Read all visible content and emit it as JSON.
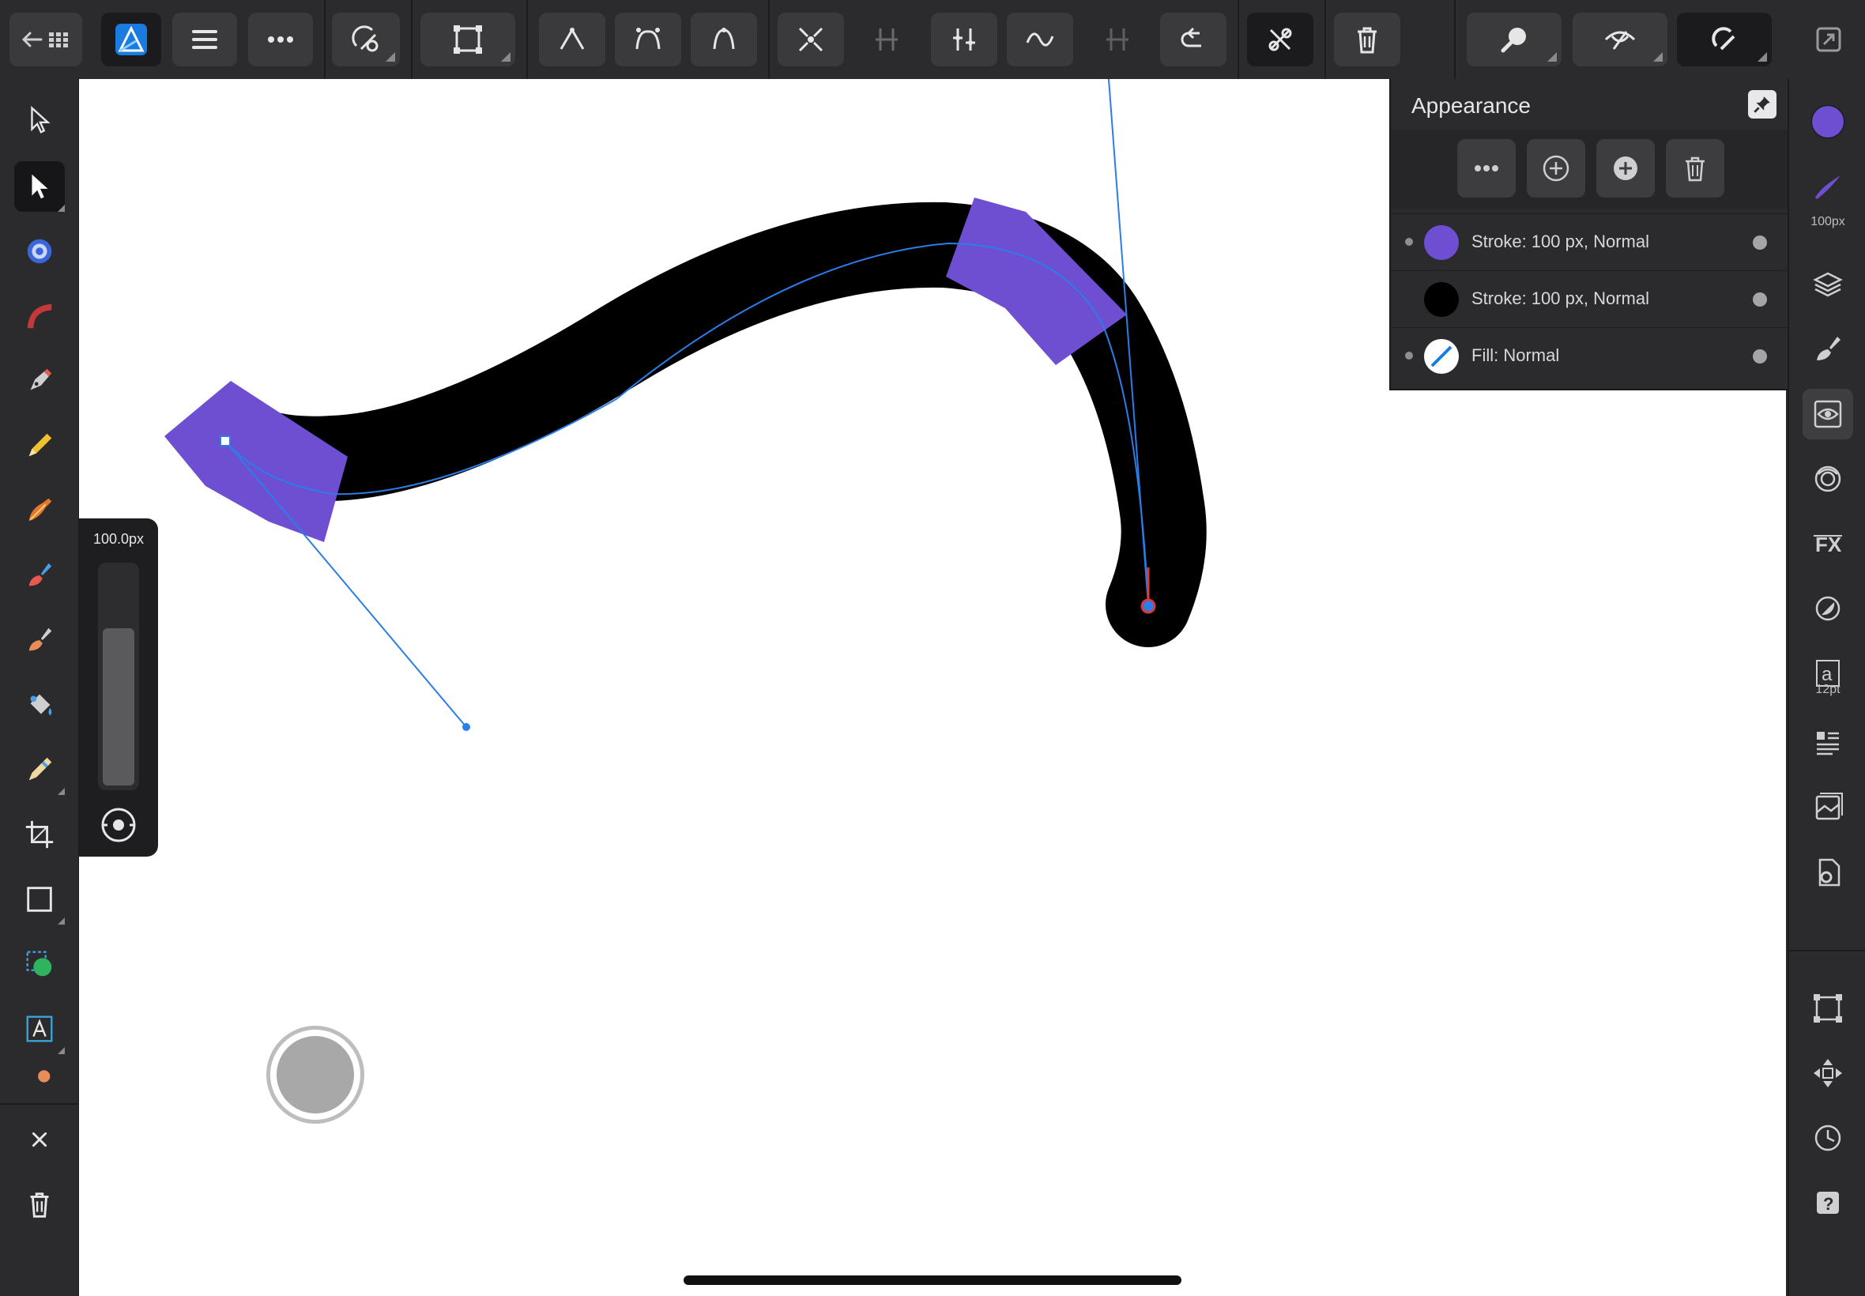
{
  "panel": {
    "title": "Appearance",
    "layers": [
      {
        "label": "Stroke: 100 px, Normal",
        "swatch": "#6e4fd1"
      },
      {
        "label": "Stroke: 100 px, Normal",
        "swatch": "#000000"
      },
      {
        "label": "Fill: Normal",
        "swatch": "none"
      }
    ]
  },
  "width_slider": {
    "value_label": "100.0px",
    "level": 0.72
  },
  "right_bar": {
    "brush_size_caption": "100px",
    "text_size_caption": "12pt",
    "text_glyph": "a",
    "fill_color": "#6e4fd1"
  },
  "colors": {
    "accent": "#6e4fd1",
    "selection_blue": "#2b7de9",
    "end_node": "#d63b3b"
  }
}
